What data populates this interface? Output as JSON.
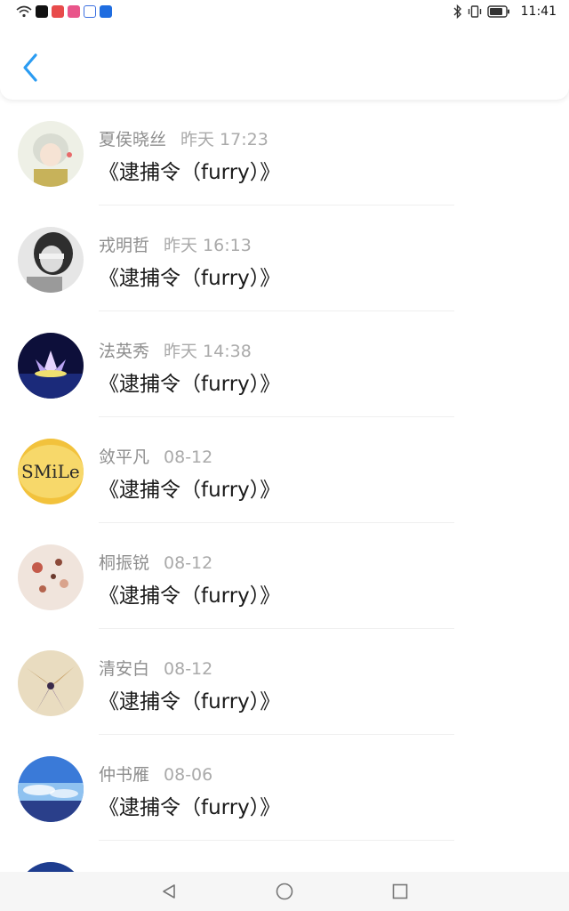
{
  "status_bar": {
    "time": "11:41",
    "icons_left": [
      "wifi-icon",
      "tiktok-icon",
      "app-icon-red",
      "app-icon-pink",
      "baidu-icon",
      "app-icon-blue"
    ],
    "icons_right": [
      "bluetooth-icon",
      "vibrate-icon",
      "battery-icon"
    ]
  },
  "header": {
    "back_icon": "chevron-left-icon",
    "accent": "#2b9cf2"
  },
  "items": [
    {
      "name": "夏侯晓丝",
      "time": "昨天 17:23",
      "title": "《逮捕令（furry）》"
    },
    {
      "name": "戎明哲",
      "time": "昨天 16:13",
      "title": "《逮捕令（furry）》"
    },
    {
      "name": "法英秀",
      "time": "昨天 14:38",
      "title": "《逮捕令（furry）》"
    },
    {
      "name": "敛平凡",
      "time": "08-12",
      "title": "《逮捕令（furry）》"
    },
    {
      "name": "桐振锐",
      "time": "08-12",
      "title": "《逮捕令（furry）》"
    },
    {
      "name": "清安白",
      "time": "08-12",
      "title": "《逮捕令（furry）》"
    },
    {
      "name": "仲书雁",
      "time": "08-06",
      "title": "《逮捕令（furry）》"
    }
  ],
  "nav_bar": {
    "back": "triangle-back-icon",
    "home": "circle-home-icon",
    "recents": "square-recents-icon"
  }
}
